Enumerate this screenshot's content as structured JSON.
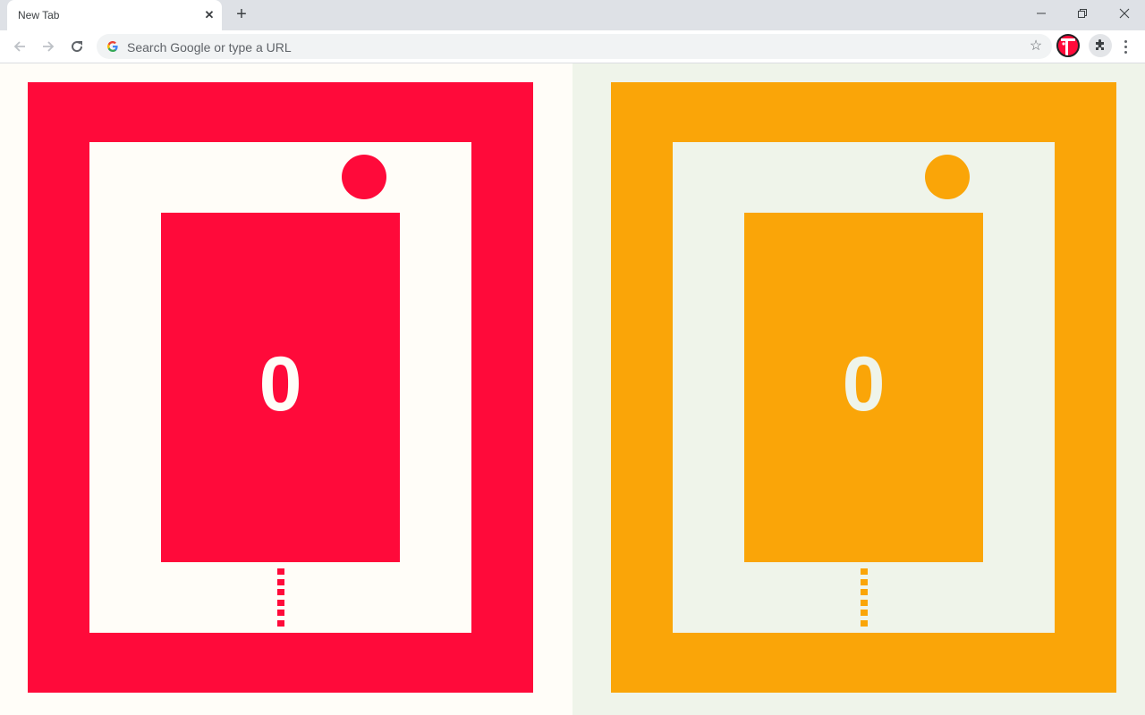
{
  "browser": {
    "tab_title": "New Tab",
    "omnibox_placeholder": "Search Google or type a URL",
    "icons": {
      "back": "arrow-left-icon",
      "forward": "arrow-right-icon",
      "reload": "reload-icon",
      "star": "star-icon",
      "extensions": "puzzle-icon",
      "menu": "kebab-menu-icon",
      "minimize": "minimize-icon",
      "restore": "restore-icon",
      "close": "close-icon"
    },
    "glyphs": {
      "tab_close": "✕",
      "new_tab": "+",
      "star": "☆",
      "minimize": "—",
      "close": "✕"
    }
  },
  "game": {
    "panels": [
      {
        "player": "left",
        "score": "0",
        "colors": {
          "accent": "#ff0a3a",
          "background": "#fffdf8"
        }
      },
      {
        "player": "right",
        "score": "0",
        "colors": {
          "accent": "#faa508",
          "background": "#eff4ea"
        }
      }
    ],
    "dot_count": 6
  }
}
